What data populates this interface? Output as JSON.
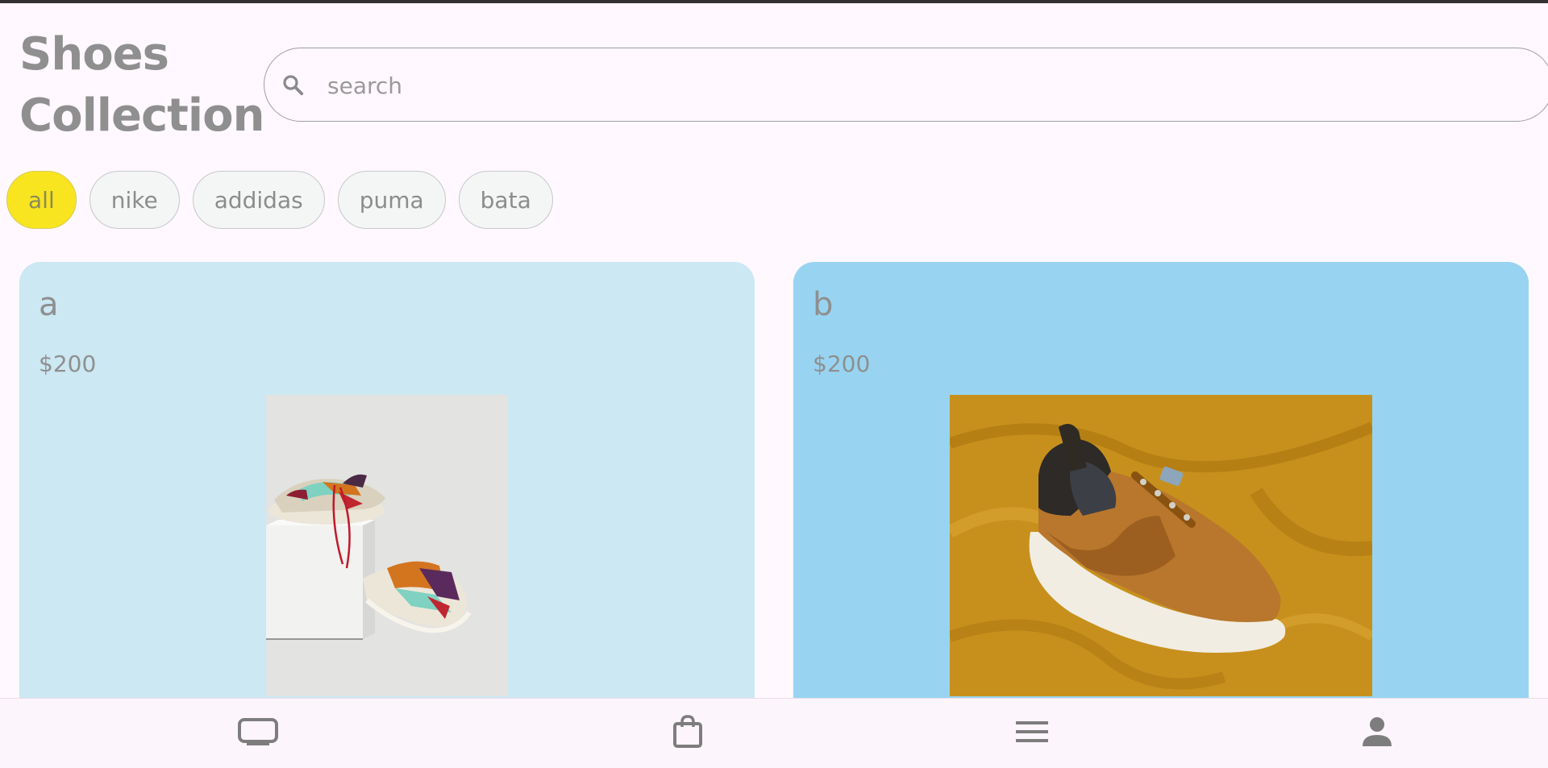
{
  "header": {
    "title_line1": "Shoes",
    "title_line2": "Collection"
  },
  "search": {
    "placeholder": "search",
    "icon": "search-icon"
  },
  "filters": [
    {
      "label": "all",
      "selected": true
    },
    {
      "label": "nike",
      "selected": false
    },
    {
      "label": "addidas",
      "selected": false
    },
    {
      "label": "puma",
      "selected": false
    },
    {
      "label": "bata",
      "selected": false
    }
  ],
  "products": [
    {
      "name": "a",
      "price": "$200",
      "card_color": "#cbe8f3"
    },
    {
      "name": "b",
      "price": "$200",
      "card_color": "#98d4f1"
    }
  ],
  "bottom_nav": [
    {
      "icon": "tv-icon"
    },
    {
      "icon": "shopping-bag-icon"
    },
    {
      "icon": "menu-icon"
    },
    {
      "icon": "person-icon"
    }
  ],
  "colors": {
    "accent_chip": "#f8e51f",
    "background": "#fff8fe",
    "text_muted": "#8f8f8f"
  }
}
